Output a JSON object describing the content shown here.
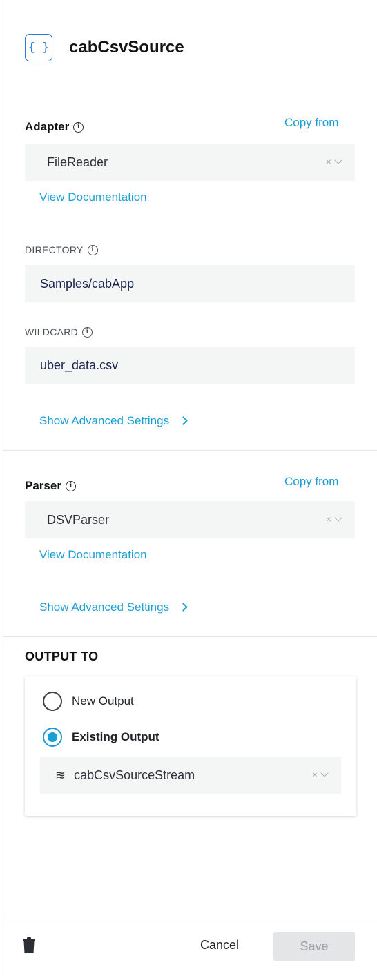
{
  "header": {
    "icon": "curly-braces-icon",
    "title": "cabCsvSource"
  },
  "adapter": {
    "label": "Adapter",
    "copy_from": "Copy from",
    "value": "FileReader",
    "clear": "×",
    "view_docs": "View Documentation",
    "directory": {
      "label": "DIRECTORY",
      "value": "Samples/cabApp"
    },
    "wildcard": {
      "label": "WILDCARD",
      "value": "uber_data.csv"
    },
    "advanced": "Show Advanced Settings"
  },
  "parser": {
    "label": "Parser",
    "copy_from": "Copy from",
    "value": "DSVParser",
    "clear": "×",
    "view_docs": "View Documentation",
    "advanced": "Show Advanced Settings"
  },
  "output": {
    "title": "OUTPUT TO",
    "options": [
      {
        "label": "New Output",
        "selected": false
      },
      {
        "label": "Existing Output",
        "selected": true
      }
    ],
    "stream_icon": "≋",
    "stream_value": "cabCsvSourceStream",
    "clear": "×"
  },
  "footer": {
    "delete_icon": "trash-icon",
    "cancel": "Cancel",
    "save": "Save"
  },
  "colors": {
    "accent": "#1a9fd4",
    "icon_blue": "#2a7bd6",
    "field_bg": "#f4f6f6"
  }
}
